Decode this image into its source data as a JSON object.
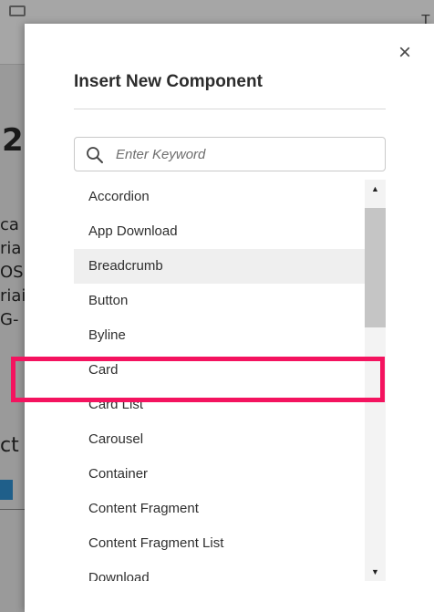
{
  "background": {
    "heading_fragment": "2",
    "lines": [
      "ca",
      "ria",
      "OS",
      "riai",
      "G-"
    ],
    "word_fragment": "ct",
    "topbar_right": "T"
  },
  "dialog": {
    "title": "Insert New Component",
    "close_label": "×",
    "search": {
      "placeholder": "Enter Keyword",
      "value": ""
    },
    "items": [
      "Accordion",
      "App Download",
      "Breadcrumb",
      "Button",
      "Byline",
      "Card",
      "Card List",
      "Carousel",
      "Container",
      "Content Fragment",
      "Content Fragment List",
      "Download"
    ],
    "hovered_item": "Breadcrumb",
    "highlighted_item": "Card"
  },
  "scrollbar": {
    "up_arrow": "▲",
    "down_arrow": "▼"
  },
  "colors": {
    "highlight": "#f4135f",
    "hover_row": "#efefef",
    "scroll_thumb": "#c5c5c5"
  }
}
